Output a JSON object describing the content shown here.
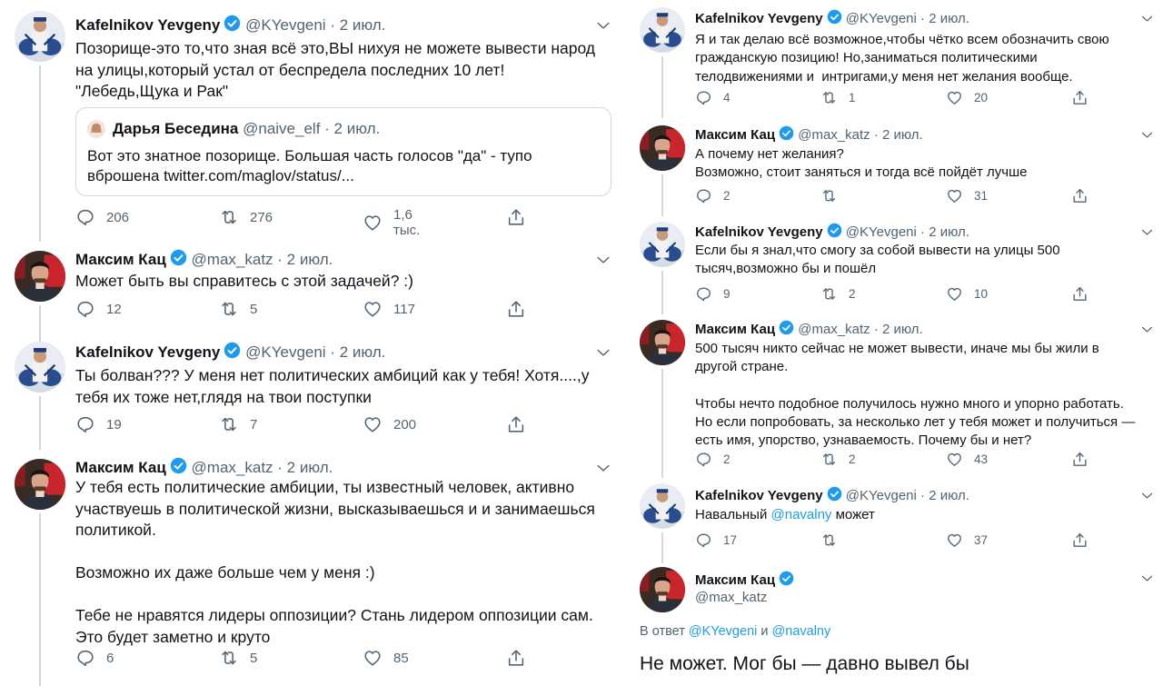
{
  "left_tweets": [
    {
      "name": "Kafelnikov Yevgeny",
      "handle": "@KYevgeni",
      "date": "2 июл.",
      "avatar_type": "kafelnikov",
      "text": "Позорище-это то,что зная всё это,ВЫ нихуя не можете вывести народ\nна улицы,который устал от беспредела последних 10 лет!\n\"Лебедь,Щука и Рак\"",
      "quote": {
        "name": "Дарья Беседина",
        "handle": "@naive_elf",
        "date": "2 июл.",
        "text": "Вот это знатное позорище. Большая часть голосов \"да\" - тупо\nвброшена twitter.com/maglov/status/..."
      },
      "replies": "206",
      "retweets": "276",
      "likes": "1,6 тыс."
    },
    {
      "name": "Максим Кац",
      "handle": "@max_katz",
      "date": "2 июл.",
      "avatar_type": "katz",
      "text": "Может быть вы справитесь с этой задачей? :)",
      "replies": "12",
      "retweets": "5",
      "likes": "117"
    },
    {
      "name": "Kafelnikov Yevgeny",
      "handle": "@KYevgeni",
      "date": "2 июл.",
      "avatar_type": "kafelnikov",
      "text": "Ты болван??? У меня нет политических амбиций как у тебя! Хотя....,у\nтебя их тоже нет,глядя на твои поступки",
      "replies": "19",
      "retweets": "7",
      "likes": "200"
    },
    {
      "name": "Максим Кац",
      "handle": "@max_katz",
      "date": "2 июл.",
      "avatar_type": "katz",
      "text": "У тебя есть политические амбиции, ты известный человек, активно\nучаствуешь в политической жизни, высказываешься и и занимаешься\nполитикой.\n\nВозможно их даже больше чем у меня :)\n\nТебе не нравятся лидеры оппозиции? Стань лидером оппозиции сам.\nЭто будет заметно и круто",
      "replies": "6",
      "retweets": "5",
      "likes": "85"
    }
  ],
  "right_tweets": [
    {
      "name": "Kafelnikov Yevgeny",
      "handle": "@KYevgeni",
      "date": "2 июл.",
      "avatar_type": "kafelnikov",
      "text": "Я и так делаю всё возможное,чтобы чётко всем обозначить свою\nгражданскую позицию! Но,заниматься политическими\nтелодвижениями и  интригами,у меня нет желания вообще.",
      "replies": "4",
      "retweets": "1",
      "likes": "20"
    },
    {
      "name": "Максим Кац",
      "handle": "@max_katz",
      "date": "2 июл.",
      "avatar_type": "katz",
      "text": "А почему нет желания?\nВозможно, стоит заняться и тогда всё пойдёт лучше",
      "replies": "2",
      "retweets": "",
      "likes": "31"
    },
    {
      "name": "Kafelnikov Yevgeny",
      "handle": "@KYevgeni",
      "date": "2 июл.",
      "avatar_type": "kafelnikov",
      "text": "Если бы я знал,что смогу за собой вывести на улицы 500\nтысяч,возможно бы и пошёл",
      "replies": "9",
      "retweets": "2",
      "likes": "10"
    },
    {
      "name": "Максим Кац",
      "handle": "@max_katz",
      "date": "2 июл.",
      "avatar_type": "katz",
      "text": "500 тысяч никто сейчас не может вывести, иначе мы бы жили в\nдругой стране.\n\nЧтобы нечто подобное получилось нужно много и упорно работать.\nНо если попробовать, за несколько лет у тебя может и получиться —\nесть имя, упорство, узнаваемость. Почему бы и нет?",
      "replies": "2",
      "retweets": "2",
      "likes": "43"
    },
    {
      "name": "Kafelnikov Yevgeny",
      "handle": "@KYevgeni",
      "date": "2 июл.",
      "avatar_type": "kafelnikov",
      "text_prefix": "Навальный ",
      "text_mention": "@navalny",
      "text_suffix": " может",
      "replies": "17",
      "retweets": "",
      "likes": "37"
    }
  ],
  "focused_tweet": {
    "name": "Максим Кац",
    "handle": "@max_katz",
    "avatar_type": "katz",
    "reply_prefix": "В ответ ",
    "reply_mention_1": "@KYevgeni",
    "reply_and": " и ",
    "reply_mention_2": "@navalny",
    "text": "Не может. Мог бы — давно вывел бы"
  },
  "colors": {
    "accent": "#1d9bf0",
    "muted": "#536471",
    "thread_line": "#cfd9de"
  }
}
